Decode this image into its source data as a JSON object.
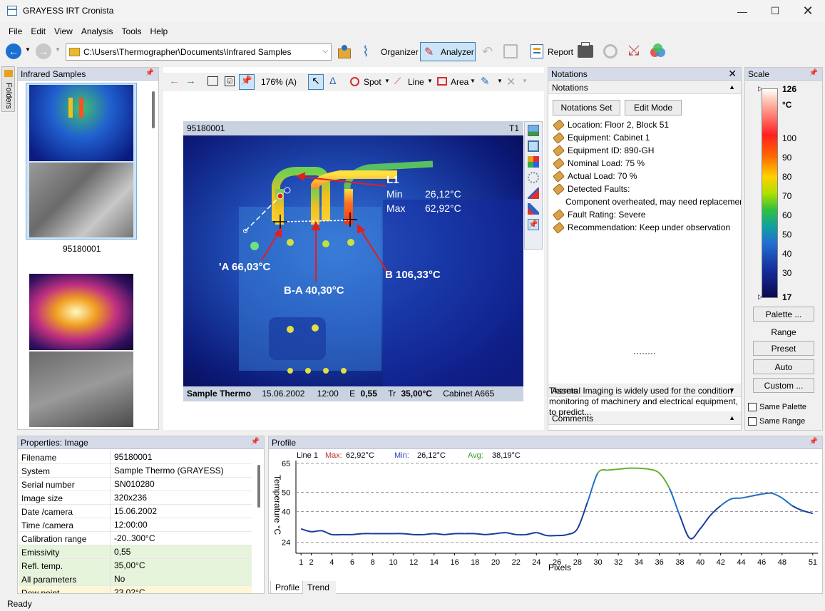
{
  "app": {
    "title": "GRAYESS IRT Cronista"
  },
  "menu": [
    "File",
    "Edit",
    "View",
    "Analysis",
    "Tools",
    "Help"
  ],
  "toolbar": {
    "path": "C:\\Users\\Thermographer\\Documents\\Infrared Samples",
    "organizer": "Organizer",
    "analyzer": "Analyzer",
    "report": "Report"
  },
  "folders_tab": "Folders",
  "thumbs": {
    "title": "Infrared Samples",
    "selected_caption": "95180001"
  },
  "image_toolbar": {
    "zoom": "176% (A)",
    "spot": "Spot",
    "line": "Line",
    "area": "Area"
  },
  "image": {
    "name": "95180001",
    "tag": "T1",
    "footer": {
      "camera": "Sample Thermo",
      "date": "15.06.2002",
      "time": "12:00",
      "e_label": "E",
      "e_value": "0,55",
      "tr_label": "Tr",
      "tr_value": "35,00°C",
      "location": "Cabinet A665"
    },
    "l1": {
      "name": "L1",
      "min_label": "Min",
      "min": "26,12°C",
      "max_label": "Max",
      "max": "62,92°C"
    },
    "a": "'A 66,03°C",
    "ba": "B-A 40,30°C",
    "b": "B 106,33°C"
  },
  "notations": {
    "title": "Notations",
    "section": "Notations",
    "btn_set": "Notations Set",
    "btn_edit": "Edit Mode",
    "items": [
      {
        "text": "Location: Floor 2, Block 51"
      },
      {
        "text": "Equipment: Cabinet 1"
      },
      {
        "text": "Equipment ID: 890-GH"
      },
      {
        "text": "Nominal Load: 75 %"
      },
      {
        "text": "Actual Load: 70 %"
      },
      {
        "text": "Detected Faults:"
      },
      {
        "text": "Component overheated, may need replacemer",
        "sub": true
      },
      {
        "text": "Fault Rating: Severe"
      },
      {
        "text": "Recommendation: Keep under observation"
      }
    ],
    "assets": "Assets",
    "comments": "Comments",
    "comment_text": "Thermal Imaging is widely used for the condition monitoring of machinery and electrical equipment, to predict..."
  },
  "scale": {
    "title": "Scale",
    "max": "126",
    "unit": "°C",
    "min": "17",
    "ticks": [
      "100",
      "90",
      "80",
      "70",
      "60",
      "50",
      "40",
      "30"
    ],
    "palette_btn": "Palette ...",
    "range_label": "Range",
    "preset": "Preset",
    "auto": "Auto",
    "custom": "Custom ...",
    "same_palette": "Same Palette",
    "same_range": "Same Range"
  },
  "properties": {
    "title": "Properties: Image",
    "rows": [
      {
        "k": "Filename",
        "v": "95180001"
      },
      {
        "k": "System",
        "v": "Sample Thermo (GRAYESS)"
      },
      {
        "k": "Serial number",
        "v": "SN010280"
      },
      {
        "k": "Image size",
        "v": "320x236"
      },
      {
        "k": "Date /camera",
        "v": "15.06.2002"
      },
      {
        "k": "Time /camera",
        "v": "12:00:00"
      },
      {
        "k": "Calibration range",
        "v": "-20..300°C"
      },
      {
        "k": "Emissivity",
        "v": "0,55",
        "hl": true
      },
      {
        "k": "Refl. temp.",
        "v": "35,00°C",
        "hl": true
      },
      {
        "k": "All parameters",
        "v": "No",
        "hl": true
      },
      {
        "k": "Dew point",
        "v": "23,02°C",
        "hl2": true
      }
    ]
  },
  "profile": {
    "title": "Profile",
    "line": "Line 1",
    "max_label": "Max:",
    "max": "62,92°C",
    "min_label": "Min:",
    "min": "26,12°C",
    "avg_label": "Avg:",
    "avg": "38,19°C",
    "tab_profile": "Profile",
    "tab_trend": "Trend"
  },
  "chart_data": {
    "type": "line",
    "xlabel": "Pixels",
    "ylabel": "Temperature °C",
    "yticks": [
      24,
      40,
      50,
      65
    ],
    "xticks": [
      1,
      2,
      4,
      6,
      8,
      10,
      12,
      14,
      16,
      18,
      20,
      22,
      24,
      26,
      28,
      30,
      32,
      34,
      36,
      38,
      40,
      42,
      44,
      46,
      48,
      51
    ],
    "series": [
      {
        "name": "Line 1",
        "x": [
          1,
          2,
          3,
          4,
          5,
          6,
          7,
          8,
          9,
          10,
          11,
          12,
          13,
          14,
          15,
          16,
          17,
          18,
          19,
          20,
          21,
          22,
          23,
          24,
          25,
          26,
          27,
          28,
          29,
          30,
          31,
          32,
          33,
          34,
          35,
          36,
          37,
          38,
          39,
          40,
          41,
          42,
          43,
          44,
          45,
          46,
          47,
          48,
          49,
          50,
          51
        ],
        "y": [
          31,
          29.5,
          30,
          28,
          28,
          28,
          28.5,
          28.5,
          28.5,
          28.5,
          28.5,
          28,
          28,
          28.5,
          28,
          28.5,
          28.5,
          28.5,
          28,
          28.5,
          29,
          28,
          28,
          29,
          27.5,
          27.5,
          28,
          31,
          45,
          60,
          61.5,
          62,
          62.5,
          62.5,
          62,
          60,
          52,
          38,
          26,
          31,
          38,
          43,
          46.5,
          47,
          48,
          49,
          49.5,
          47,
          43,
          40.5,
          39
        ]
      }
    ]
  },
  "status": "Ready"
}
